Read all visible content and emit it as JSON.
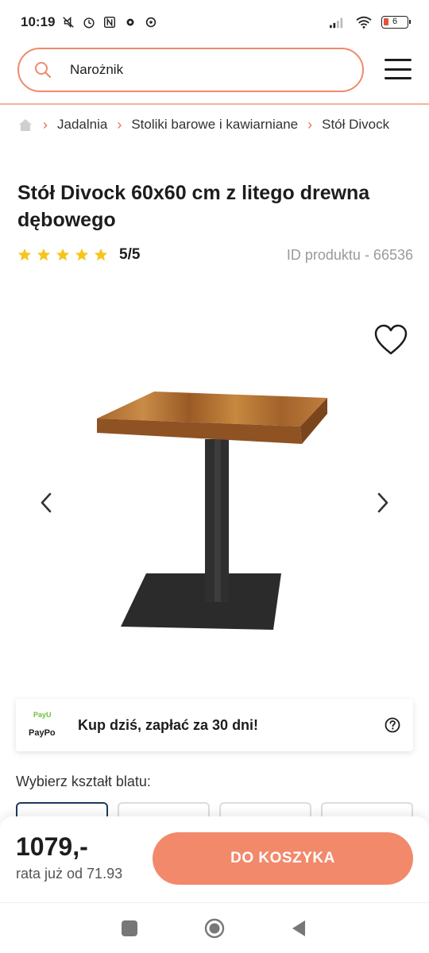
{
  "status_bar": {
    "time": "10:19",
    "battery": "6"
  },
  "search": {
    "value": "Narożnik"
  },
  "breadcrumb": {
    "items": [
      "Jadalnia",
      "Stoliki barowe i kawiarniane",
      "Stół Divock"
    ]
  },
  "product": {
    "title": "Stół Divock 60x60 cm z litego drewna dębowego",
    "rating": "5/5",
    "rating_stars": 5,
    "product_id": "ID produktu - 66536"
  },
  "paypo": {
    "logo_top": "PayU",
    "logo_bottom": "PayPo",
    "text": "Kup dziś, zapłać za 30 dni!"
  },
  "shape": {
    "label": "Wybierz kształt blatu:"
  },
  "purchase": {
    "price": "1079,-",
    "installment": "rata już od 71.93",
    "cart_button": "DO KOSZYKA"
  },
  "colors": {
    "accent": "#f2896b",
    "star": "#f5c518",
    "selected_border": "#1e3a5f"
  }
}
